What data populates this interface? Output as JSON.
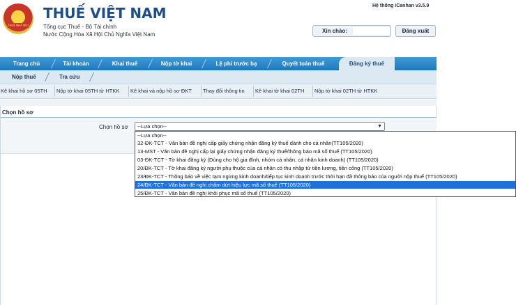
{
  "header": {
    "title": "THUẾ VIỆT NAM",
    "subtitle1": "Tổng cục Thuế - Bộ Tài chính",
    "subtitle2": "Nước Cộng Hòa Xã Hội Chủ Nghĩa Việt Nam",
    "version": "Hệ thống iCanhan v3.5.9",
    "greeting": "Xin chào:",
    "username": "",
    "logout": "Đăng xuất",
    "emblem_text": "THUẾ NHÀ NƯỚC"
  },
  "nav": {
    "tabs": [
      {
        "label": "Trang chủ"
      },
      {
        "label": "Tài khoản"
      },
      {
        "label": "Khai thuế"
      },
      {
        "label": "Nộp tờ khai"
      },
      {
        "label": "Lệ phí trước bạ"
      },
      {
        "label": "Quyết toán thuế"
      },
      {
        "label": "Đăng ký thuế"
      }
    ],
    "active_index": 6
  },
  "subnav": {
    "items": [
      {
        "label": "Nộp thuế"
      },
      {
        "label": "Tra cứu"
      }
    ]
  },
  "functions": {
    "links": [
      {
        "label": "Kê khai hồ sơ 05TH"
      },
      {
        "label": "Nộp tờ khai 05TH từ HTKK"
      },
      {
        "label": "Kê khai và nộp hồ sơ ĐKT"
      },
      {
        "label": "Thay đổi thông tin"
      },
      {
        "label": "Kê khai tờ khai 02TH"
      },
      {
        "label": "Nộp tờ khai 02TH từ HTKK"
      }
    ]
  },
  "form": {
    "section_title": "Chọn hồ sơ",
    "field_label": "Chọn hồ sơ",
    "selected_value": "--Lựa chọn--",
    "options": [
      {
        "label": "--Lựa chọn--"
      },
      {
        "label": "32-ĐK-TCT - Văn bản đề nghị cấp giấy chứng nhận đăng ký thuế dành cho cá nhân(TT105/2020)"
      },
      {
        "label": "13-MST - Văn bản đề nghị cấp lại giấy chứng nhận đăng ký thuế/thông báo mã số thuế (TT105/2020)"
      },
      {
        "label": "03-ĐK-TCT - Tờ khai đăng ký (Dùng cho hộ gia đình, nhóm cá nhân, cá nhân kinh doanh) (TT105/2020)"
      },
      {
        "label": "20/ĐK-TCT - Tờ khai đăng ký người phụ thuộc của cá nhân có thu nhập từ tiền lương, tiền công (TT105/2020)"
      },
      {
        "label": "23/ĐK-TCT - Thông báo về việc tạm ngừng kinh doanh/tiếp tục kinh doanh trước thời hạn đã thông báo của người nộp thuế (TT105/2020)"
      },
      {
        "label": "24/ĐK-TCT - Văn bản đề nghị chấm dứt hiệu lực mã số thuế (TT105/2020)"
      },
      {
        "label": "25/ĐK-TCT - Văn bản đề nghị khôi phục mã số thuế (TT105/2020)"
      }
    ],
    "highlighted_index": 6
  },
  "colors": {
    "brand": "#1c4f8a",
    "nav_bg": "#2a85c8",
    "highlight": "#1e6fe0"
  }
}
